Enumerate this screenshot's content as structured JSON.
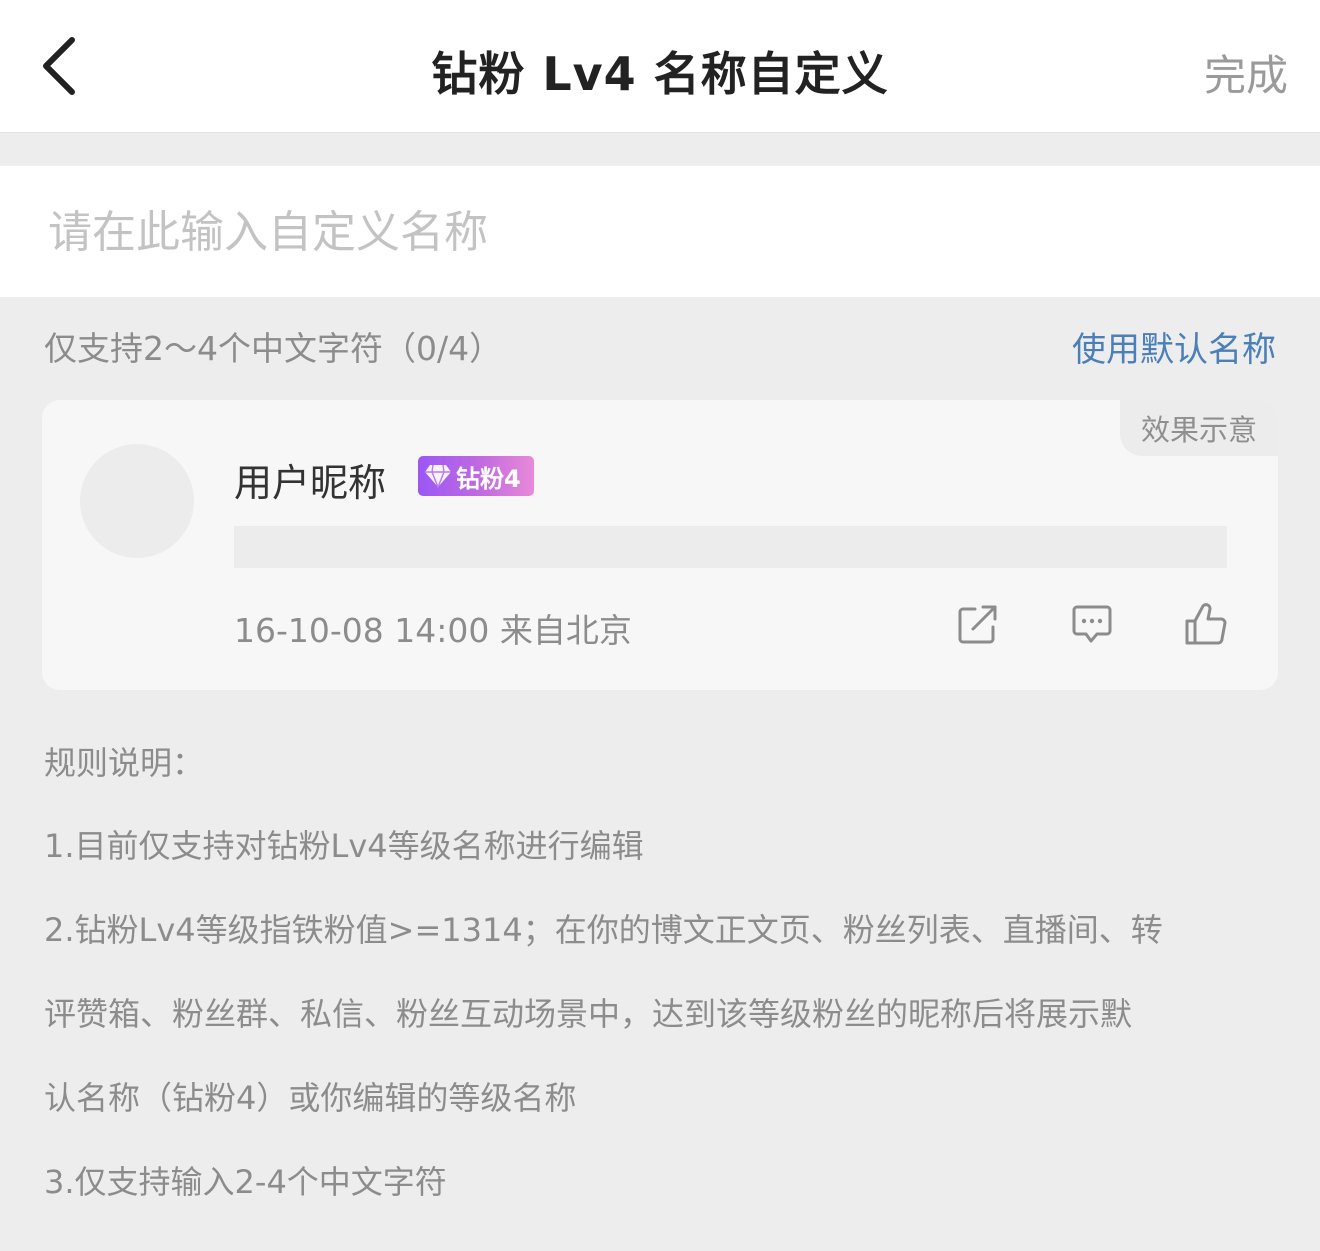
{
  "header": {
    "title": "钻粉 Lv4 名称自定义",
    "done_label": "完成"
  },
  "input": {
    "placeholder": "请在此输入自定义名称",
    "value": ""
  },
  "hint": {
    "text": "仅支持2～4个中文字符（0/4）",
    "use_default_label": "使用默认名称"
  },
  "preview": {
    "tag": "效果示意",
    "nickname": "用户昵称",
    "badge": {
      "label": "钻粉4",
      "icon": "diamond-icon",
      "gradient": [
        "#9b57f5",
        "#e88ad9"
      ]
    },
    "meta": "16-10-08 14:00 来自北京",
    "actions": [
      {
        "icon": "share-icon"
      },
      {
        "icon": "comment-icon"
      },
      {
        "icon": "like-icon"
      }
    ]
  },
  "rules": {
    "title": "规则说明：",
    "lines": [
      "1.目前仅支持对钻粉Lv4等级名称进行编辑",
      "2.钻粉Lv4等级指铁粉值>=1314；在你的博文正文页、粉丝列表、直播间、转",
      "评赞箱、粉丝群、私信、粉丝互动场景中，达到该等级粉丝的昵称后将展示默",
      "认名称（钻粉4）或你编辑的等级名称",
      "3.仅支持输入2-4个中文字符"
    ]
  },
  "colors": {
    "accent": "#4a7fb8",
    "background": "#ededed",
    "card": "#f7f7f7"
  }
}
